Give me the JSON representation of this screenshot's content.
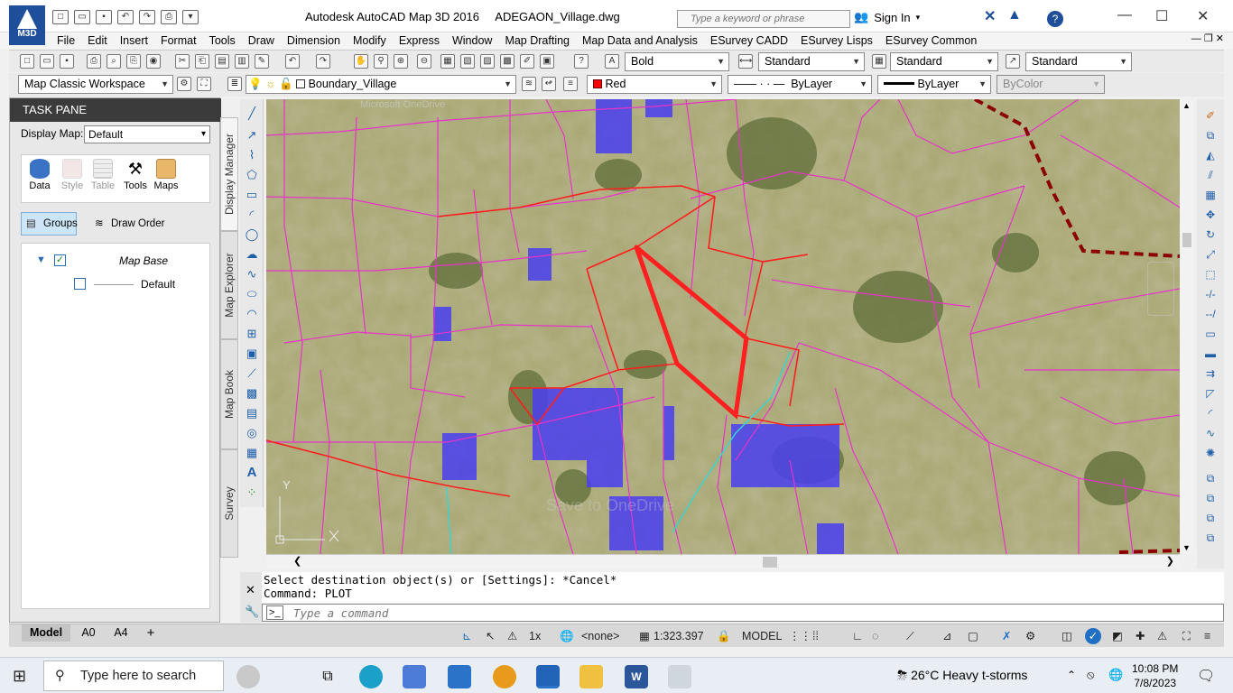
{
  "app": {
    "logo_text": "M3D",
    "title": "Autodesk AutoCAD Map 3D 2016",
    "filename": "ADEGAON_Village.dwg",
    "search_placeholder": "Type a keyword or phrase",
    "sign_in": "Sign In"
  },
  "menu": [
    "File",
    "Edit",
    "Insert",
    "Format",
    "Tools",
    "Draw",
    "Dimension",
    "Modify",
    "Express",
    "Window",
    "Map Drafting",
    "Map Data and Analysis",
    "ESurvey CADD",
    "ESurvey Lisps",
    "ESurvey Common"
  ],
  "toolbar1": {
    "text_style": "Bold",
    "dim_style": "Standard",
    "table_style": "Standard",
    "mleader_style": "Standard"
  },
  "toolbar2": {
    "workspace": "Map Classic Workspace",
    "layer": "Boundary_Village",
    "color": "Red",
    "color_hex": "#ff0000",
    "linetype": "ByLayer",
    "lineweight": "ByLayer",
    "plotstyle": "ByColor"
  },
  "taskpane": {
    "title": "TASK PANE",
    "display_map_label": "Display Map:",
    "display_map_value": "Default",
    "ribbon": [
      "Data",
      "Style",
      "Table",
      "Tools",
      "Maps"
    ],
    "groups_label": "Groups",
    "draw_order_label": "Draw Order",
    "tree": {
      "root": "Map Base",
      "child": "Default"
    },
    "vertical_tabs": [
      "Display Manager",
      "Map Explorer",
      "Map Book",
      "Survey"
    ]
  },
  "canvas": {
    "watermark": "Microsoft OneDrive",
    "ghost_text": "Save to OneDrive",
    "ucs_y": "Y",
    "ucs_x": "X",
    "colors": {
      "parcel": "#e833c8",
      "boundary": "#ff1e1e",
      "village": "#8b0000",
      "stream": "#35d6d6"
    }
  },
  "command": {
    "line1": "Select destination object(s) or [Settings]: *Cancel*",
    "line2": "Command: PLOT",
    "placeholder": "Type a command"
  },
  "status": {
    "layout_tabs": [
      "Model",
      "A0",
      "A4"
    ],
    "scale_zoom": "1x",
    "annotation": "<none>",
    "scale": "1:323.397",
    "space": "MODEL"
  },
  "taskbar": {
    "search_placeholder": "Type here to search",
    "weather_temp": "26°C",
    "weather_text": "Heavy t-storms",
    "time": "10:08 PM",
    "date": "7/8/2023"
  }
}
